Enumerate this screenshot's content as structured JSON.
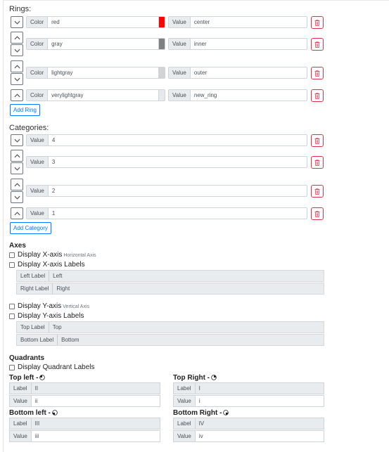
{
  "rings": {
    "heading": "Rings:",
    "color_label": "Color",
    "value_label": "Value",
    "items": [
      {
        "color": "red",
        "swatch": "#ff0000",
        "value": "center"
      },
      {
        "color": "gray",
        "swatch": "#808080",
        "value": "inner"
      },
      {
        "color": "lightgray",
        "swatch": "#d3d3d3",
        "value": "outer"
      },
      {
        "color": "verylightgray",
        "swatch": "#e6e8eb",
        "value": "new_ring"
      }
    ],
    "add_label": "Add Ring"
  },
  "categories": {
    "heading": "Categories:",
    "value_label": "Value",
    "items": [
      "4",
      "3",
      "2",
      "1"
    ],
    "add_label": "Add Category"
  },
  "axes": {
    "heading": "Axes",
    "x_axis_label": "Display X-axis",
    "x_axis_note": "Horizontal Axis",
    "x_labels_label": "Display X-axis Labels",
    "left_label_caption": "Left Label",
    "left_label_value": "Left",
    "right_label_caption": "Right Label",
    "right_label_value": "Right",
    "y_axis_label": "Display Y-axis",
    "y_axis_note": "Vertical Axis",
    "y_labels_label": "Display Y-axis Labels",
    "top_label_caption": "Top Label",
    "top_label_value": "Top",
    "bottom_label_caption": "Bottom Label",
    "bottom_label_value": "Bottom"
  },
  "quadrants": {
    "heading": "Quadrants",
    "display_label": "Display Quadrant Labels",
    "label_caption": "Label",
    "value_caption": "Value",
    "top_left": {
      "title": "Top left -",
      "label": "II",
      "value": "ii"
    },
    "top_right": {
      "title": "Top Right -",
      "label": "I",
      "value": "i"
    },
    "bottom_left": {
      "title": "Bottom left -",
      "label": "III",
      "value": "iii"
    },
    "bottom_right": {
      "title": "Bottom Right -",
      "label": "IV",
      "value": "iv"
    }
  },
  "colors": {
    "primary": "#007bff",
    "danger": "#dc3545",
    "addon_bg": "#e9ecef"
  }
}
